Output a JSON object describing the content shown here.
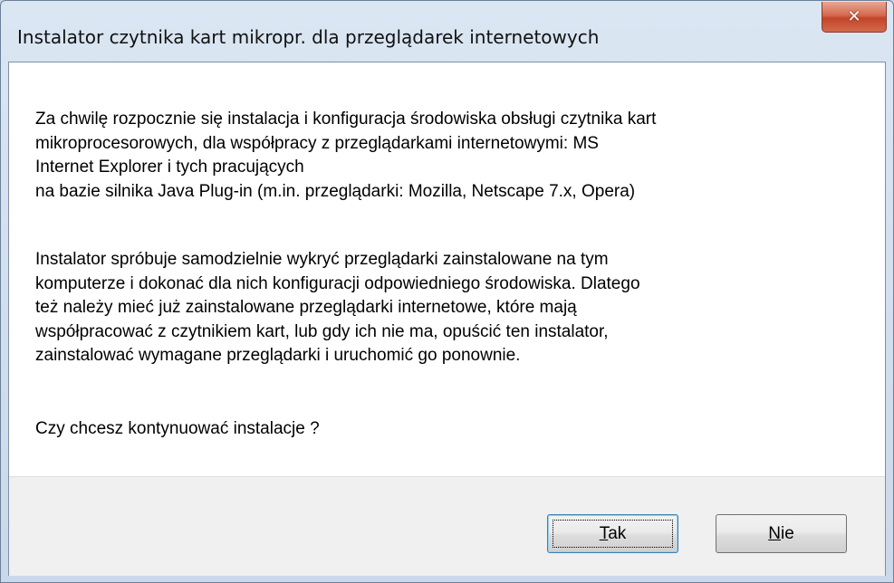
{
  "window": {
    "title": "Instalator czytnika kart mikropr. dla przeglądarek internetowych",
    "close_icon": "close-icon"
  },
  "message": {
    "paragraph1": "Za chwilę rozpocznie się instalacja i konfiguracja środowiska obsługi czytnika kart\nmikroprocesorowych, dla współpracy z przeglądarkami internetowymi: MS\nInternet Explorer i tych pracujących\nna bazie silnika Java Plug-in (m.in. przeglądarki: Mozilla, Netscape 7.x, Opera)",
    "paragraph2": "Instalator spróbuje samodzielnie wykryć przeglądarki zainstalowane na tym\nkomputerze i dokonać dla nich konfiguracji odpowiedniego środowiska. Dlatego\nteż należy mieć już zainstalowane przeglądarki internetowe, które mają\nwspółpracować z czytnikiem kart, lub gdy ich nie ma, opuścić ten instalator,\nzainstalować wymagane przeglądarki i uruchomić go ponownie.",
    "question": "Czy chcesz kontynuować instalacje ?"
  },
  "buttons": {
    "yes": {
      "accel": "T",
      "rest": "ak"
    },
    "no": {
      "accel": "N",
      "rest": "ie"
    }
  }
}
